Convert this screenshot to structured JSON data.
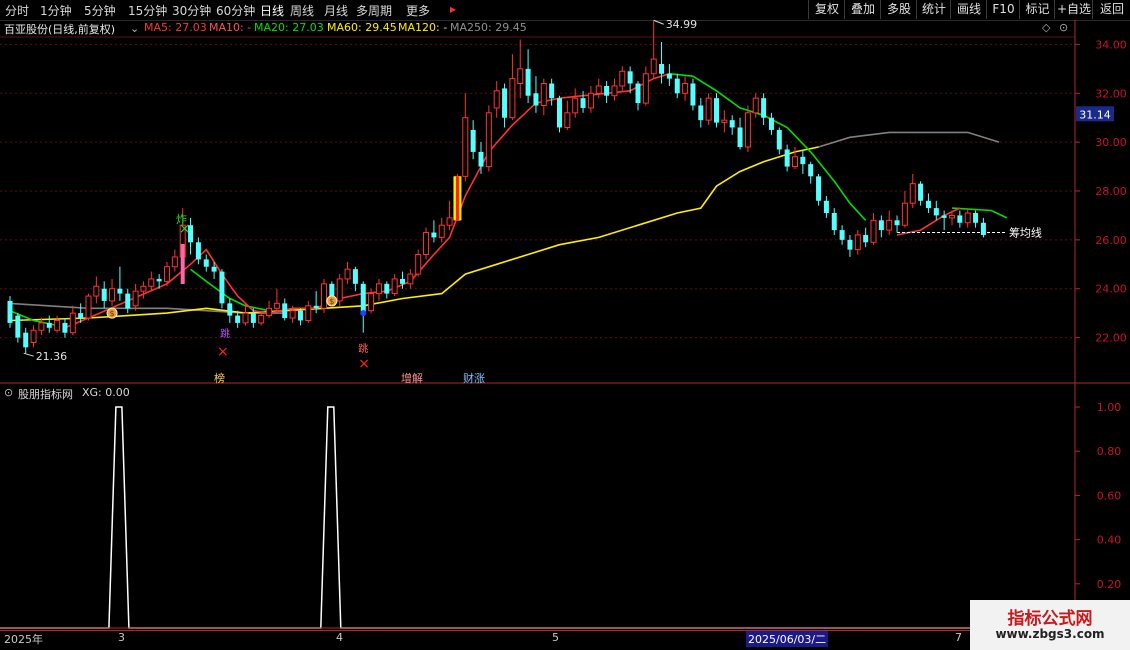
{
  "toolbar": {
    "left_tabs": [
      "分时",
      "1分钟",
      "5分钟",
      "15分钟",
      "30分钟",
      "60分钟",
      "日线",
      "周线",
      "月线",
      "多周期",
      "更多"
    ],
    "active_tab": "日线",
    "more_arrow": "▸",
    "right_buttons": [
      "复权",
      "叠加",
      "多股",
      "统计",
      "画线",
      "F10",
      "标记",
      "+自选",
      "返回"
    ]
  },
  "legend": {
    "title": "百亚股份(日线,前复权)",
    "ma5": "MA5: 27.03",
    "ma10": "MA10: -",
    "ma20": "MA20: 27.03",
    "ma60": "MA60: 29.45",
    "ma120": "MA120: -",
    "ma250": "MA250: 29.45",
    "icons": [
      "dropdown-icon",
      "diamond-icon",
      "settings-icon"
    ]
  },
  "main_axis": {
    "ticks": [
      "34.00",
      "32.00",
      "30.00",
      "28.00",
      "26.00",
      "24.00",
      "22.00"
    ],
    "current_price": "31.14",
    "high_label": "34.99",
    "low_label": "21.36",
    "avg_cost_label": "筹均线"
  },
  "markers": {
    "zha": "炸",
    "bang": "榜",
    "zengjian": "增解",
    "caizhang": "财涨",
    "tiao1": "跳",
    "tiao2": "跳"
  },
  "sub_chart": {
    "title": "股朋指标网",
    "xg": "XG: 0.00",
    "ticks": [
      "1.00",
      "0.80",
      "0.60",
      "0.40",
      "0.20"
    ]
  },
  "date_bar": {
    "labels": [
      "2025年",
      "3",
      "4",
      "5",
      "2025/06/03/二",
      "7"
    ]
  },
  "watermark": {
    "line1": "指标公式网",
    "line2": "www.zbgs3.com"
  },
  "colors": {
    "up": "#ff3232",
    "down": "#54ffff",
    "ma5": "#ff3232",
    "ma10": "#ffffff",
    "ma20": "#00dd00",
    "ma60": "#ffee00",
    "ma250": "#808080",
    "grid": "#5a1010",
    "axis": "#b0282e"
  },
  "chart_data": {
    "type": "candlestick",
    "ylim": [
      21.0,
      35.0
    ],
    "sub_ylim": [
      0.0,
      1.05
    ],
    "candles": [
      {
        "o": 23.5,
        "c": 22.6,
        "h": 23.7,
        "l": 22.4
      },
      {
        "o": 22.9,
        "c": 22.0,
        "h": 23.0,
        "l": 21.8
      },
      {
        "o": 22.2,
        "c": 21.6,
        "h": 22.4,
        "l": 21.36
      },
      {
        "o": 21.8,
        "c": 22.3,
        "h": 22.5,
        "l": 21.6
      },
      {
        "o": 22.3,
        "c": 22.6,
        "h": 22.8,
        "l": 22.1
      },
      {
        "o": 22.6,
        "c": 22.4,
        "h": 22.9,
        "l": 22.2
      },
      {
        "o": 22.3,
        "c": 22.7,
        "h": 22.9,
        "l": 22.2
      },
      {
        "o": 22.6,
        "c": 22.2,
        "h": 22.8,
        "l": 22.0
      },
      {
        "o": 22.2,
        "c": 23.0,
        "h": 23.3,
        "l": 22.1
      },
      {
        "o": 23.0,
        "c": 22.8,
        "h": 23.4,
        "l": 22.6
      },
      {
        "o": 22.8,
        "c": 23.7,
        "h": 23.8,
        "l": 22.7
      },
      {
        "o": 23.7,
        "c": 24.1,
        "h": 24.5,
        "l": 23.4
      },
      {
        "o": 24.0,
        "c": 23.5,
        "h": 24.3,
        "l": 23.2
      },
      {
        "o": 23.5,
        "c": 24.0,
        "h": 24.4,
        "l": 23.3
      },
      {
        "o": 24.0,
        "c": 23.8,
        "h": 24.9,
        "l": 23.5
      },
      {
        "o": 23.8,
        "c": 23.2,
        "h": 24.0,
        "l": 23.0
      },
      {
        "o": 23.3,
        "c": 23.9,
        "h": 24.2,
        "l": 23.1
      },
      {
        "o": 23.9,
        "c": 24.1,
        "h": 24.3,
        "l": 23.6
      },
      {
        "o": 24.1,
        "c": 24.4,
        "h": 24.7,
        "l": 23.9
      },
      {
        "o": 24.4,
        "c": 24.3,
        "h": 24.6,
        "l": 24.0
      },
      {
        "o": 24.3,
        "c": 24.9,
        "h": 25.1,
        "l": 24.1
      },
      {
        "o": 24.9,
        "c": 25.3,
        "h": 25.6,
        "l": 24.7
      },
      {
        "o": 25.3,
        "c": 26.6,
        "h": 27.3,
        "l": 25.1
      },
      {
        "o": 26.6,
        "c": 25.9,
        "h": 26.9,
        "l": 25.4
      },
      {
        "o": 25.9,
        "c": 25.2,
        "h": 26.1,
        "l": 25.0
      },
      {
        "o": 25.2,
        "c": 24.9,
        "h": 25.4,
        "l": 24.7
      },
      {
        "o": 24.9,
        "c": 24.7,
        "h": 25.1,
        "l": 24.4
      },
      {
        "o": 24.7,
        "c": 23.4,
        "h": 24.8,
        "l": 23.2
      },
      {
        "o": 23.4,
        "c": 22.9,
        "h": 23.6,
        "l": 22.6
      },
      {
        "o": 22.9,
        "c": 22.6,
        "h": 23.1,
        "l": 22.4
      },
      {
        "o": 22.6,
        "c": 23.0,
        "h": 23.4,
        "l": 22.5
      },
      {
        "o": 23.0,
        "c": 22.6,
        "h": 23.2,
        "l": 22.4
      },
      {
        "o": 22.6,
        "c": 22.9,
        "h": 23.1,
        "l": 22.5
      },
      {
        "o": 22.9,
        "c": 23.2,
        "h": 23.5,
        "l": 22.8
      },
      {
        "o": 23.2,
        "c": 23.4,
        "h": 24.0,
        "l": 23.1
      },
      {
        "o": 23.4,
        "c": 22.8,
        "h": 23.6,
        "l": 22.7
      },
      {
        "o": 22.8,
        "c": 23.1,
        "h": 23.3,
        "l": 22.6
      },
      {
        "o": 23.1,
        "c": 22.7,
        "h": 23.2,
        "l": 22.5
      },
      {
        "o": 22.7,
        "c": 23.3,
        "h": 23.5,
        "l": 22.6
      },
      {
        "o": 23.3,
        "c": 23.2,
        "h": 23.9,
        "l": 23.0
      },
      {
        "o": 23.2,
        "c": 24.2,
        "h": 24.4,
        "l": 23.0
      },
      {
        "o": 24.2,
        "c": 23.5,
        "h": 24.3,
        "l": 23.4
      },
      {
        "o": 23.5,
        "c": 24.4,
        "h": 24.6,
        "l": 23.3
      },
      {
        "o": 24.4,
        "c": 24.8,
        "h": 25.1,
        "l": 24.2
      },
      {
        "o": 24.8,
        "c": 24.2,
        "h": 24.9,
        "l": 23.9
      },
      {
        "o": 24.2,
        "c": 23.0,
        "h": 24.3,
        "l": 22.2
      },
      {
        "o": 23.1,
        "c": 23.8,
        "h": 24.0,
        "l": 23.0
      },
      {
        "o": 23.8,
        "c": 24.2,
        "h": 24.4,
        "l": 23.5
      },
      {
        "o": 24.2,
        "c": 23.8,
        "h": 24.3,
        "l": 23.6
      },
      {
        "o": 23.8,
        "c": 24.4,
        "h": 24.6,
        "l": 23.7
      },
      {
        "o": 24.4,
        "c": 24.2,
        "h": 24.7,
        "l": 24.0
      },
      {
        "o": 24.2,
        "c": 24.6,
        "h": 24.8,
        "l": 24.0
      },
      {
        "o": 24.6,
        "c": 25.4,
        "h": 25.6,
        "l": 24.5
      },
      {
        "o": 25.4,
        "c": 26.3,
        "h": 26.5,
        "l": 25.2
      },
      {
        "o": 26.3,
        "c": 26.1,
        "h": 26.8,
        "l": 25.9
      },
      {
        "o": 26.1,
        "c": 26.6,
        "h": 26.9,
        "l": 25.9
      },
      {
        "o": 26.6,
        "c": 26.9,
        "h": 27.6,
        "l": 26.4
      },
      {
        "o": 26.8,
        "c": 28.6,
        "h": 28.7,
        "l": 26.8
      },
      {
        "o": 28.6,
        "c": 31.0,
        "h": 32.0,
        "l": 28.4
      },
      {
        "o": 30.5,
        "c": 29.6,
        "h": 30.9,
        "l": 29.3
      },
      {
        "o": 29.6,
        "c": 29.0,
        "h": 30.0,
        "l": 28.7
      },
      {
        "o": 29.0,
        "c": 31.2,
        "h": 31.5,
        "l": 28.8
      },
      {
        "o": 31.4,
        "c": 32.1,
        "h": 32.5,
        "l": 31.0
      },
      {
        "o": 32.2,
        "c": 31.0,
        "h": 32.4,
        "l": 30.6
      },
      {
        "o": 31.0,
        "c": 32.6,
        "h": 33.6,
        "l": 30.9
      },
      {
        "o": 32.4,
        "c": 33.0,
        "h": 34.2,
        "l": 31.8
      },
      {
        "o": 33.0,
        "c": 31.9,
        "h": 33.8,
        "l": 31.6
      },
      {
        "o": 32.0,
        "c": 31.5,
        "h": 32.7,
        "l": 31.2
      },
      {
        "o": 31.5,
        "c": 32.4,
        "h": 32.6,
        "l": 31.1
      },
      {
        "o": 32.4,
        "c": 31.8,
        "h": 32.6,
        "l": 31.5
      },
      {
        "o": 31.8,
        "c": 30.6,
        "h": 31.9,
        "l": 30.4
      },
      {
        "o": 30.6,
        "c": 31.2,
        "h": 31.7,
        "l": 30.5
      },
      {
        "o": 31.2,
        "c": 31.8,
        "h": 32.2,
        "l": 31.0
      },
      {
        "o": 31.8,
        "c": 31.4,
        "h": 32.1,
        "l": 31.2
      },
      {
        "o": 31.4,
        "c": 32.0,
        "h": 32.3,
        "l": 31.2
      },
      {
        "o": 32.0,
        "c": 32.3,
        "h": 32.6,
        "l": 31.8
      },
      {
        "o": 32.3,
        "c": 31.9,
        "h": 32.5,
        "l": 31.6
      },
      {
        "o": 31.9,
        "c": 32.3,
        "h": 32.6,
        "l": 31.7
      },
      {
        "o": 32.3,
        "c": 32.9,
        "h": 33.1,
        "l": 32.1
      },
      {
        "o": 32.9,
        "c": 32.4,
        "h": 33.1,
        "l": 32.0
      },
      {
        "o": 32.4,
        "c": 31.6,
        "h": 32.5,
        "l": 31.3
      },
      {
        "o": 31.6,
        "c": 32.8,
        "h": 33.1,
        "l": 31.5
      },
      {
        "o": 32.8,
        "c": 33.4,
        "h": 34.99,
        "l": 32.6
      },
      {
        "o": 33.2,
        "c": 32.8,
        "h": 34.1,
        "l": 32.4
      },
      {
        "o": 32.8,
        "c": 32.6,
        "h": 33.2,
        "l": 32.3
      },
      {
        "o": 32.6,
        "c": 32.0,
        "h": 32.8,
        "l": 31.8
      },
      {
        "o": 32.0,
        "c": 32.4,
        "h": 32.7,
        "l": 31.7
      },
      {
        "o": 32.4,
        "c": 31.5,
        "h": 32.6,
        "l": 31.3
      },
      {
        "o": 31.5,
        "c": 30.9,
        "h": 31.8,
        "l": 30.6
      },
      {
        "o": 30.9,
        "c": 31.8,
        "h": 32.0,
        "l": 30.7
      },
      {
        "o": 31.8,
        "c": 30.8,
        "h": 32.0,
        "l": 30.6
      },
      {
        "o": 30.8,
        "c": 30.9,
        "h": 31.3,
        "l": 30.4
      },
      {
        "o": 30.9,
        "c": 30.6,
        "h": 31.1,
        "l": 30.3
      },
      {
        "o": 30.6,
        "c": 29.8,
        "h": 31.0,
        "l": 29.7
      },
      {
        "o": 29.8,
        "c": 31.2,
        "h": 31.5,
        "l": 29.6
      },
      {
        "o": 31.2,
        "c": 31.8,
        "h": 32.0,
        "l": 31.0
      },
      {
        "o": 31.8,
        "c": 31.0,
        "h": 32.0,
        "l": 30.7
      },
      {
        "o": 31.0,
        "c": 30.5,
        "h": 31.2,
        "l": 30.3
      },
      {
        "o": 30.5,
        "c": 29.7,
        "h": 30.6,
        "l": 29.5
      },
      {
        "o": 29.7,
        "c": 29.0,
        "h": 29.9,
        "l": 28.8
      },
      {
        "o": 29.0,
        "c": 29.4,
        "h": 29.8,
        "l": 28.9
      },
      {
        "o": 29.4,
        "c": 29.1,
        "h": 29.7,
        "l": 28.7
      },
      {
        "o": 29.1,
        "c": 28.6,
        "h": 29.2,
        "l": 28.3
      },
      {
        "o": 28.6,
        "c": 27.6,
        "h": 28.7,
        "l": 27.4
      },
      {
        "o": 27.6,
        "c": 27.1,
        "h": 27.8,
        "l": 26.9
      },
      {
        "o": 27.1,
        "c": 26.4,
        "h": 27.3,
        "l": 26.2
      },
      {
        "o": 26.4,
        "c": 26.0,
        "h": 26.6,
        "l": 25.8
      },
      {
        "o": 26.0,
        "c": 25.6,
        "h": 26.2,
        "l": 25.3
      },
      {
        "o": 25.6,
        "c": 26.2,
        "h": 26.4,
        "l": 25.4
      },
      {
        "o": 26.2,
        "c": 25.9,
        "h": 26.5,
        "l": 25.7
      },
      {
        "o": 25.9,
        "c": 26.8,
        "h": 27.1,
        "l": 25.8
      },
      {
        "o": 26.8,
        "c": 26.4,
        "h": 27.0,
        "l": 26.1
      },
      {
        "o": 26.4,
        "c": 26.8,
        "h": 27.2,
        "l": 26.2
      },
      {
        "o": 26.8,
        "c": 26.6,
        "h": 27.0,
        "l": 26.3
      },
      {
        "o": 26.6,
        "c": 27.5,
        "h": 28.0,
        "l": 26.5
      },
      {
        "o": 27.5,
        "c": 28.3,
        "h": 28.7,
        "l": 27.3
      },
      {
        "o": 28.3,
        "c": 27.6,
        "h": 28.4,
        "l": 27.4
      },
      {
        "o": 27.6,
        "c": 27.3,
        "h": 27.9,
        "l": 27.1
      },
      {
        "o": 27.3,
        "c": 27.0,
        "h": 27.6,
        "l": 26.8
      },
      {
        "o": 27.0,
        "c": 26.9,
        "h": 27.2,
        "l": 26.4
      },
      {
        "o": 26.9,
        "c": 27.0,
        "h": 27.2,
        "l": 26.6
      },
      {
        "o": 27.0,
        "c": 26.7,
        "h": 27.2,
        "l": 26.5
      },
      {
        "o": 26.7,
        "c": 27.1,
        "h": 27.3,
        "l": 26.5
      },
      {
        "o": 27.1,
        "c": 26.7,
        "h": 27.2,
        "l": 26.5
      },
      {
        "o": 26.7,
        "c": 26.2,
        "h": 26.9,
        "l": 26.1
      }
    ],
    "ma5": [
      [
        7,
        22.4
      ],
      [
        10,
        22.8
      ],
      [
        15,
        23.5
      ],
      [
        20,
        24.2
      ],
      [
        23,
        25.0
      ],
      [
        25,
        25.6
      ],
      [
        27,
        24.6
      ],
      [
        29,
        23.7
      ],
      [
        31,
        23.1
      ],
      [
        33,
        23.0
      ],
      [
        36,
        23.2
      ],
      [
        39,
        23.2
      ],
      [
        42,
        23.6
      ],
      [
        45,
        23.8
      ],
      [
        48,
        23.9
      ],
      [
        51,
        24.3
      ],
      [
        54,
        25.4
      ],
      [
        56,
        26.1
      ],
      [
        58,
        27.8
      ],
      [
        61,
        29.6
      ],
      [
        64,
        30.7
      ],
      [
        67,
        31.6
      ],
      [
        70,
        31.8
      ],
      [
        73,
        31.9
      ],
      [
        76,
        32.0
      ],
      [
        79,
        32.1
      ],
      [
        82,
        32.6
      ],
      [
        84,
        32.8
      ]
    ],
    "ma20": [
      [
        0,
        23.1
      ],
      [
        3,
        22.7
      ],
      [
        6,
        22.5
      ],
      [
        23,
        24.8
      ],
      [
        25,
        24.3
      ],
      [
        28,
        23.6
      ],
      [
        30,
        23.3
      ],
      [
        33,
        23.1
      ],
      [
        84,
        32.8
      ],
      [
        87,
        32.7
      ],
      [
        90,
        32.1
      ],
      [
        93,
        31.4
      ],
      [
        96,
        31.1
      ],
      [
        99,
        30.6
      ],
      [
        102,
        29.6
      ],
      [
        105,
        28.4
      ],
      [
        107,
        27.5
      ],
      [
        109,
        26.8
      ],
      [
        120,
        27.3
      ],
      [
        125,
        27.2
      ],
      [
        127,
        26.9
      ]
    ],
    "ma5_b": [
      [
        113,
        26.2
      ],
      [
        116,
        26.4
      ],
      [
        119,
        27.0
      ],
      [
        121,
        27.3
      ]
    ],
    "ma60": [
      [
        0,
        22.7
      ],
      [
        10,
        22.8
      ],
      [
        15,
        22.9
      ],
      [
        20,
        23.0
      ],
      [
        25,
        23.2
      ],
      [
        30,
        23.0
      ],
      [
        35,
        23.1
      ],
      [
        40,
        23.2
      ],
      [
        45,
        23.3
      ],
      [
        50,
        23.6
      ],
      [
        55,
        23.8
      ],
      [
        58,
        24.6
      ],
      [
        62,
        25.0
      ],
      [
        66,
        25.4
      ],
      [
        70,
        25.8
      ],
      [
        75,
        26.1
      ],
      [
        80,
        26.6
      ],
      [
        85,
        27.1
      ],
      [
        88,
        27.3
      ],
      [
        90,
        28.2
      ],
      [
        93,
        28.8
      ],
      [
        96,
        29.2
      ],
      [
        100,
        29.6
      ],
      [
        103,
        29.8
      ]
    ],
    "ma250": [
      [
        0,
        23.4
      ],
      [
        10,
        23.2
      ],
      [
        20,
        23.2
      ],
      [
        30,
        23.0
      ],
      [
        35,
        23.0
      ],
      [
        103,
        29.8
      ],
      [
        107,
        30.2
      ],
      [
        112,
        30.4
      ],
      [
        117,
        30.4
      ],
      [
        122,
        30.4
      ],
      [
        126,
        30.0
      ]
    ],
    "xg_pulses": [
      14,
      41
    ]
  }
}
